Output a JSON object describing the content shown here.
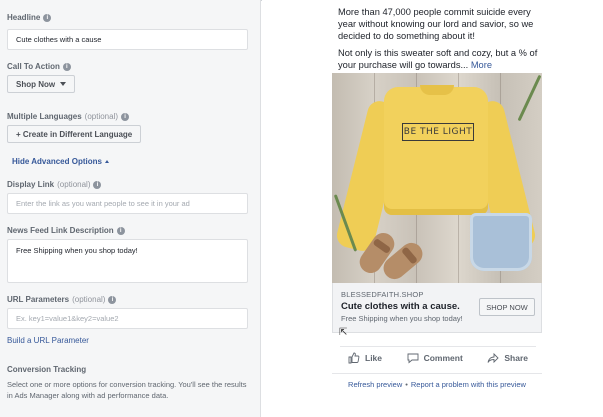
{
  "editor": {
    "headline": {
      "label": "Headline",
      "value": "Cute clothes with a cause"
    },
    "cta": {
      "label": "Call To Action",
      "selected": "Shop Now"
    },
    "languages": {
      "label": "Multiple Languages",
      "optional": "(optional)",
      "button": "+  Create in Different Language"
    },
    "advanced_toggle": "Hide Advanced Options",
    "display_link": {
      "label": "Display Link",
      "optional": "(optional)",
      "placeholder": "Enter the link as you want people to see it in your ad"
    },
    "news_feed_desc": {
      "label": "News Feed Link Description",
      "value": "Free Shipping when you shop today!"
    },
    "url_params": {
      "label": "URL Parameters",
      "optional": "(optional)",
      "placeholder": "Ex. key1=value1&key2=value2"
    },
    "build_url": "Build a URL Parameter",
    "conversion": {
      "label": "Conversion Tracking",
      "help": "Select one or more options for conversion tracking. You'll see the results in Ads Manager along with ad performance data."
    }
  },
  "preview": {
    "body_p1": "More than 47,000 people commit suicide every year without knowing our lord and savior, so we decided to do something about it!",
    "body_p2": "Not only is this sweater soft and cozy, but a % of your purchase will go towards...",
    "more": "More",
    "image_print": "BE THE LIGHT",
    "domain": "BLESSEDFAITH.SHOP",
    "headline": "Cute clothes with a cause.",
    "description": "Free Shipping when you shop today!",
    "cta_button": "SHOP NOW",
    "actions": {
      "like": "Like",
      "comment": "Comment",
      "share": "Share"
    },
    "refresh": "Refresh preview",
    "separator": "•",
    "report": "Report a problem with this preview"
  },
  "colors": {
    "link": "#365899",
    "sweater": "#f2d15c",
    "panel_bg": "#f5f6f7"
  }
}
